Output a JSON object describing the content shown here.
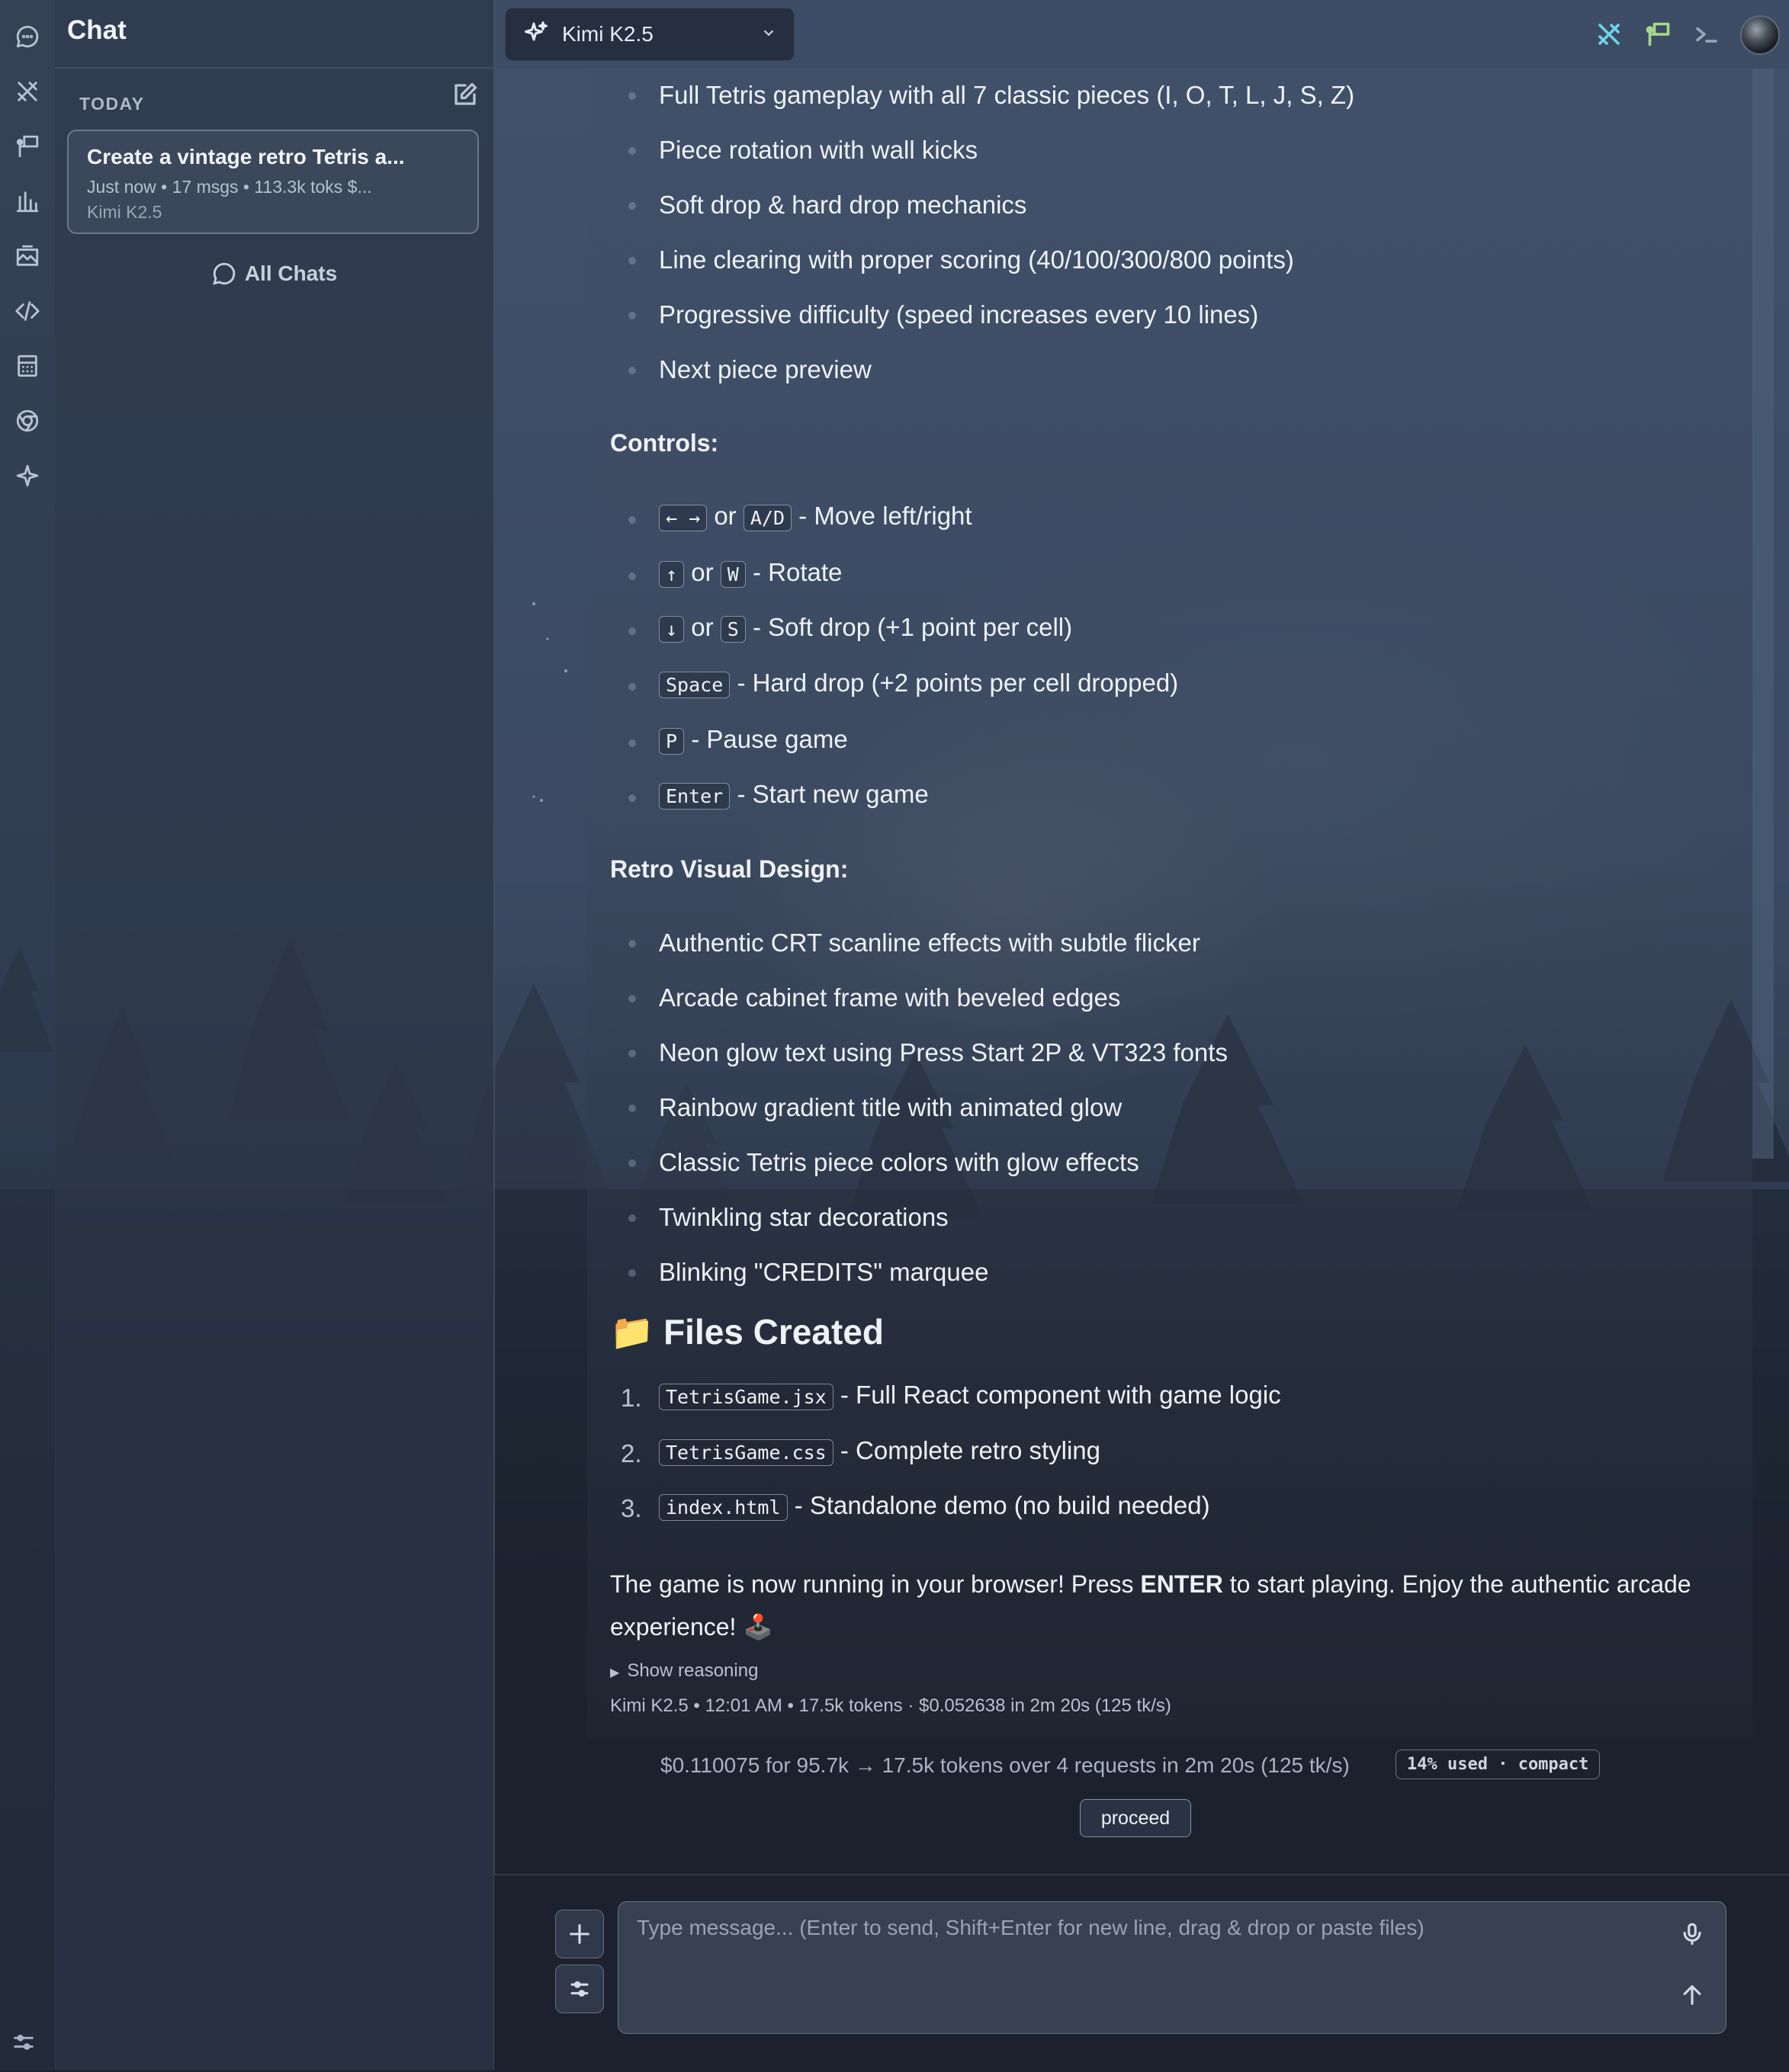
{
  "window": {
    "sidebar_title": "Chat"
  },
  "sidebar": {
    "section_label": "TODAY",
    "chat_item": {
      "title": "Create a vintage retro Tetris a...",
      "meta": "Just now • 17 msgs • 113.3k toks $...",
      "model": "Kimi K2.5"
    },
    "all_chats_label": "All Chats"
  },
  "rail_icons": [
    "chat-icon",
    "tools-icon",
    "presentation-icon",
    "bar-chart-icon",
    "image-gallery-icon",
    "code-icon",
    "calculator-icon",
    "browser-icon",
    "sparkle-icon",
    "settings-sliders-icon"
  ],
  "header": {
    "model_name": "Kimi K2.5",
    "icon_colors": {
      "tools": "#6fd3e6",
      "presentation": "#a6d88a",
      "terminal": "#9aa6b7"
    }
  },
  "message": {
    "features": [
      "Full Tetris gameplay with all 7 classic pieces (I, O, T, L, J, S, Z)",
      "Piece rotation with wall kicks",
      "Soft drop & hard drop mechanics",
      "Line clearing with proper scoring (40/100/300/800 points)",
      "Progressive difficulty (speed increases every 10 lines)",
      "Next piece preview"
    ],
    "controls_heading": "Controls:",
    "controls": [
      {
        "keys": [
          "← →",
          "A/D"
        ],
        "sep": "or",
        "desc": "- Move left/right"
      },
      {
        "keys": [
          "↑",
          "W"
        ],
        "sep": "or",
        "desc": "- Rotate"
      },
      {
        "keys": [
          "↓",
          "S"
        ],
        "sep": "or",
        "desc": "- Soft drop (+1 point per cell)"
      },
      {
        "keys": [
          "Space"
        ],
        "desc": "- Hard drop (+2 points per cell dropped)"
      },
      {
        "keys": [
          "P"
        ],
        "desc": "- Pause game"
      },
      {
        "keys": [
          "Enter"
        ],
        "desc": "- Start new game"
      }
    ],
    "visual_heading": "Retro Visual Design:",
    "visual_items": [
      "Authentic CRT scanline effects with subtle flicker",
      "Arcade cabinet frame with beveled edges",
      "Neon glow text using Press Start 2P & VT323 fonts",
      "Rainbow gradient title with animated glow",
      "Classic Tetris piece colors with glow effects",
      "Twinkling star decorations",
      "Blinking \"CREDITS\" marquee"
    ],
    "files_heading_icon": "📁",
    "files_heading": "Files Created",
    "files": [
      {
        "num": "1.",
        "name": "TetrisGame.jsx",
        "desc": "- Full React component with game logic"
      },
      {
        "num": "2.",
        "name": "TetrisGame.css",
        "desc": "- Complete retro styling"
      },
      {
        "num": "3.",
        "name": "index.html",
        "desc": "- Standalone demo (no build needed)"
      }
    ],
    "closing_before": "The game is now running in your browser! Press ",
    "closing_bold": "ENTER",
    "closing_after": " to start playing. Enjoy the authentic arcade experience! 🕹️",
    "show_reasoning": "Show reasoning",
    "meta": "Kimi K2.5 • 12:01 AM • 17.5k tokens · $0.052638 in 2m 20s (125 tk/s)"
  },
  "usage": {
    "summary": "$0.110075 for 95.7k → 17.5k tokens over 4 requests in 2m 20s (125 tk/s)",
    "badge": "14% used · compact",
    "proceed_label": "proceed"
  },
  "composer": {
    "placeholder": "Type message... (Enter to send, Shift+Enter for new line, drag & drop or paste files)",
    "value": ""
  }
}
